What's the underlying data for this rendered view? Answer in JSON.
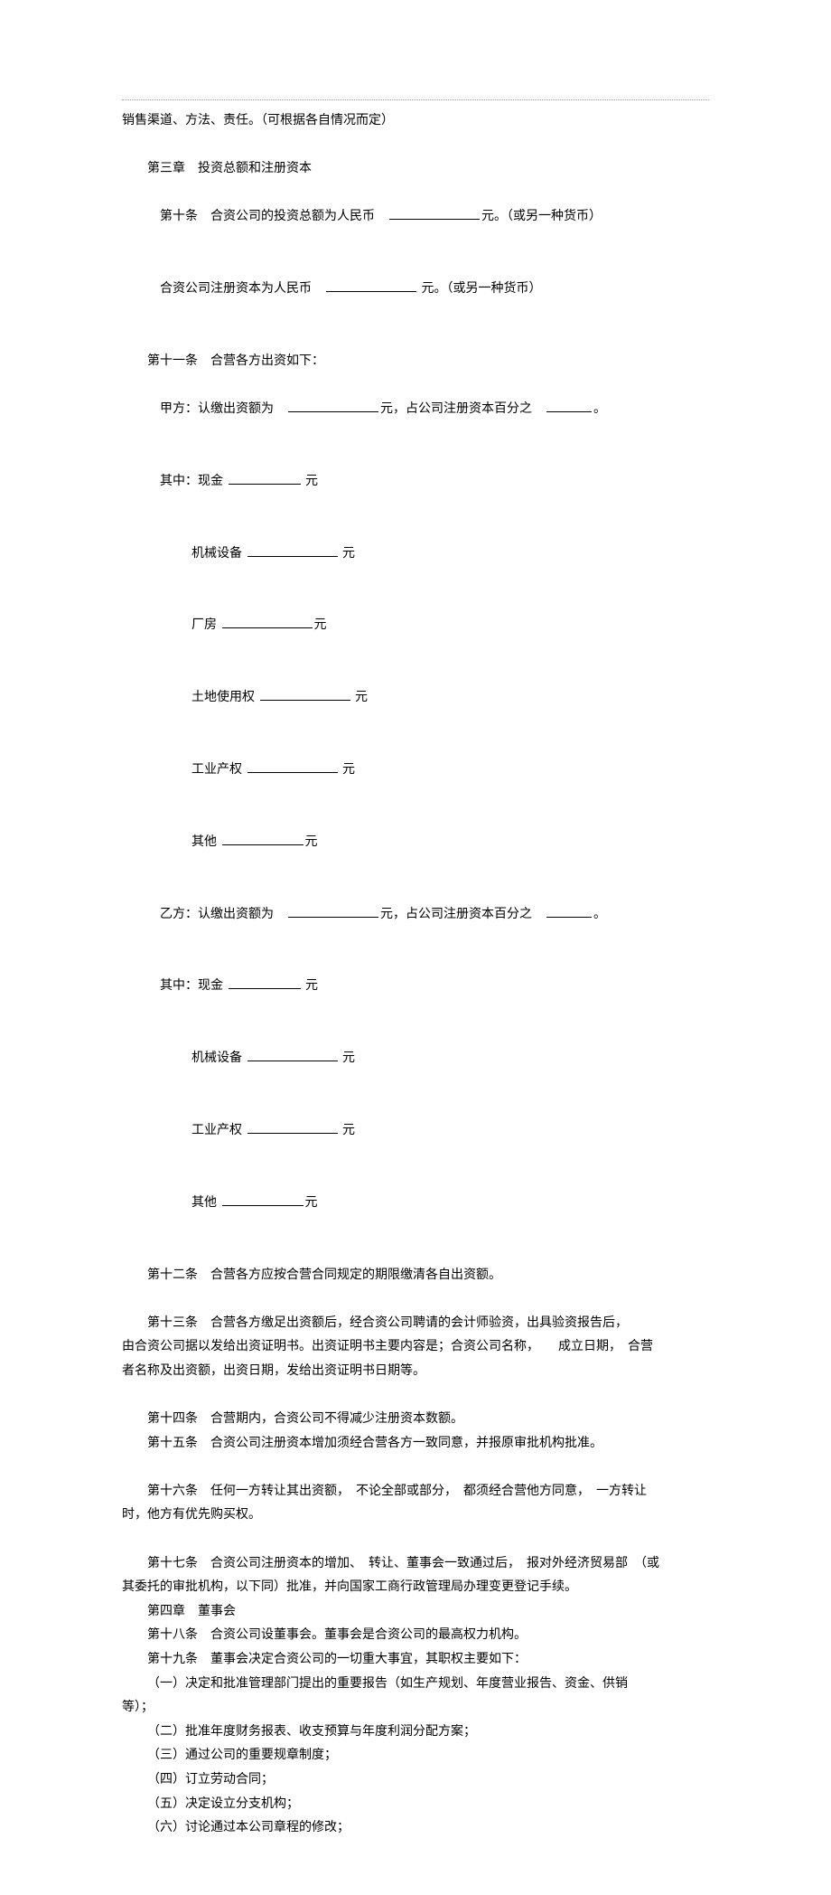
{
  "l0": "销售渠道、方法、责任。（可根据各自情况而定）",
  "chapter3": "第三章　投资总额和注册资本",
  "a10_pre": "第十条　合资公司的投资总额为人民币　",
  "a10_post": "元。（或另一种货币）",
  "a10b_pre": "合资公司注册资本为人民币　",
  "a10b_mid": " 元。（或另一种货币）",
  "a11": "第十一条　合营各方出资如下：",
  "jia_pre": "甲方：认缴出资额为　",
  "jia_mid": "元，占公司注册资本百分之　",
  "jia_post": "。",
  "qz_xj_pre": "其中：现金 ",
  "qz_xj_post": " 元",
  "jxsb_pre": "机械设备 ",
  "jxsb_post": " 元",
  "cf_pre": "厂房 ",
  "cf_post": "元",
  "tdsyq_pre": "土地使用权 ",
  "tdsyq_post": " 元",
  "gycq_pre": "工业产权 ",
  "gycq_post": " 元",
  "qt_pre": "其他 ",
  "qt_post": "元",
  "yi_pre": "乙方：认缴出资额为　",
  "yi_mid": "元，占公司注册资本百分之　",
  "yi_post": "。",
  "a12": "第十二条　合营各方应按合营合同规定的期限缴清各自出资额。",
  "a13a": "第十三条　合营各方缴足出资额后，经合资公司聘请的会计师验资，出具验资报告后，",
  "a13b": "由合资公司据以发给出资证明书。出资证明书主要内容是；合资公司名称，　　成立日期，　合营",
  "a13c": "者名称及出资额，出资日期，发给出资证明书日期等。",
  "a14": "第十四条　合营期内，合资公司不得减少注册资本数额。",
  "a15": "第十五条　合资公司注册资本增加须经合营各方一致同意，并报原审批机构批准。",
  "a16a": "第十六条　任何一方转让其出资额，　不论全部或部分，　都须经合营他方同意，　一方转让",
  "a16b": "时，他方有优先购买权。",
  "a17a": "第十七条　合资公司注册资本的增加、　转让、董事会一致通过后，　报对外经济贸易部　（或",
  "a17b": "其委托的审批机构，以下同）批准，并向国家工商行政管理局办理变更登记手续。",
  "chapter4": "第四章　董事会",
  "a18": "第十八条　合资公司设董事会。董事会是合资公司的最高权力机构。",
  "a19": "第十九条　董事会决定合资公司的一切重大事宜，其职权主要如下：",
  "i1a": "（一）决定和批准管理部门提出的重要报告（如生产规划、年度营业报告、资金、供销",
  "i1b": "等）；",
  "i2": "（二）批准年度财务报表、收支预算与年度利润分配方案；",
  "i3": "（三）通过公司的重要规章制度；",
  "i4": "（四）订立劳动合同；",
  "i5": "（五）决定设立分支机构；",
  "i6": "（六）讨论通过本公司章程的修改；"
}
